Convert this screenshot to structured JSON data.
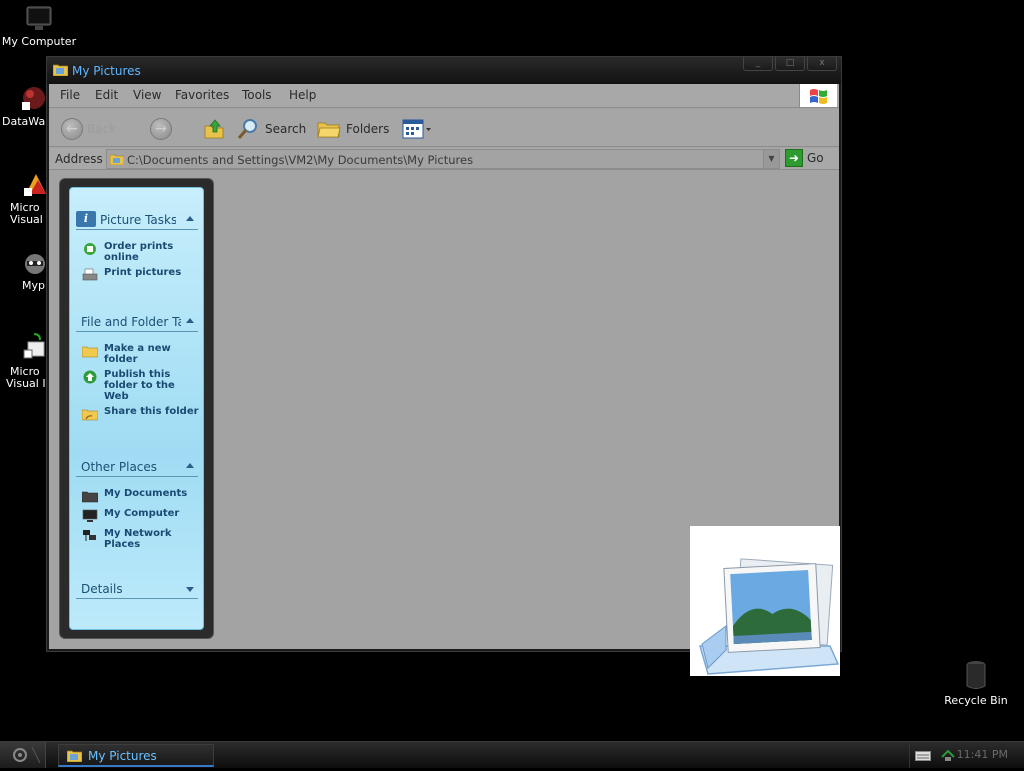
{
  "desktop": {
    "icons": [
      {
        "label": "My Computer"
      },
      {
        "label": "DataWa"
      },
      {
        "label": "Micro"
      },
      {
        "label": "Visual"
      },
      {
        "label": "Myp"
      },
      {
        "label": "Micro"
      },
      {
        "label": "Visual I"
      }
    ],
    "recycle_bin": "Recycle Bin"
  },
  "window": {
    "title": "My Pictures",
    "buttons": {
      "minimize": "_",
      "maximize": "□",
      "close": "x"
    }
  },
  "menubar": {
    "items": [
      "File",
      "Edit",
      "View",
      "Favorites",
      "Tools",
      "Help"
    ]
  },
  "toolbar": {
    "back": "Back",
    "search": "Search",
    "folders": "Folders"
  },
  "address": {
    "label": "Address",
    "value": "C:\\Documents and Settings\\VM2\\My Documents\\My Pictures",
    "go": "Go"
  },
  "taskpane": {
    "picture_tasks": {
      "title": "Picture Tasks",
      "items": [
        "Order prints online",
        "Print pictures"
      ]
    },
    "file_folder_tasks": {
      "title": "File and Folder Tasks",
      "items": [
        "Make a new folder",
        "Publish this folder to the Web",
        "Share this folder"
      ]
    },
    "other_places": {
      "title": "Other Places",
      "items": [
        "My Documents",
        "My Computer",
        "My Network Places"
      ]
    },
    "details": {
      "title": "Details"
    }
  },
  "taskbar": {
    "active_window": "My Pictures",
    "clock": "11:41 PM"
  },
  "colors": {
    "title_text": "#5fb6ff",
    "client_bg": "#a3a3a3",
    "taskpane_bg": "#9fdcf3",
    "task_text": "#1a4a72"
  }
}
